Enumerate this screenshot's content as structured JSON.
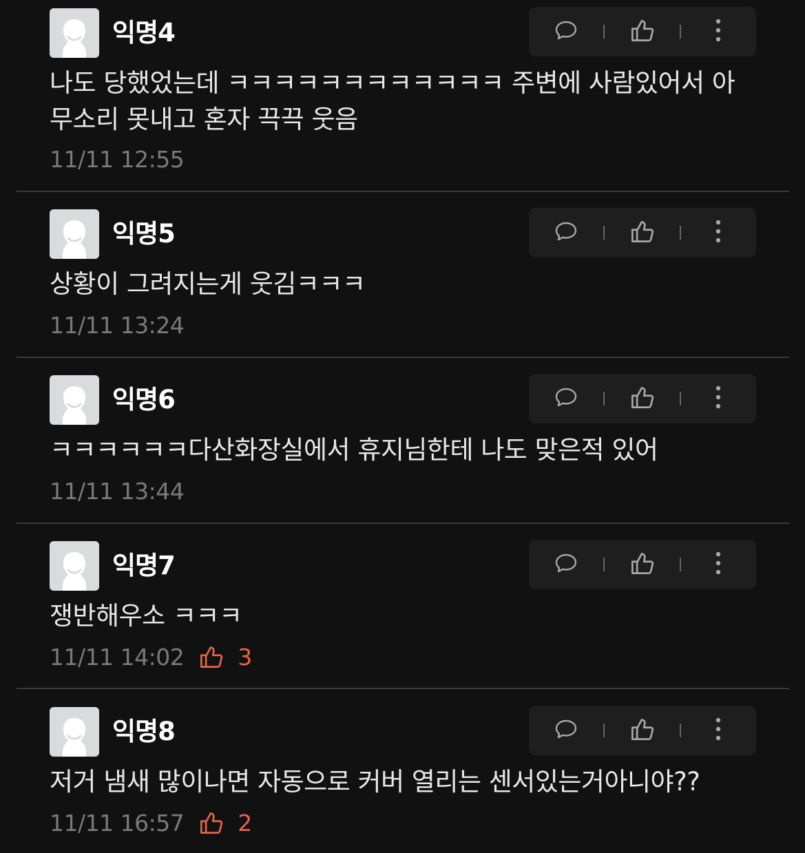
{
  "comments": [
    {
      "author": "익명4",
      "text": "나도 당했었는데 ㅋㅋㅋㅋㅋㅋㅋㅋㅋㅋㅋㅋ 주변에 사람있어서 아무소리 못내고 혼자 끅끅 웃음",
      "time": "11/11 12:55",
      "likes": null
    },
    {
      "author": "익명5",
      "text": "상황이 그려지는게 웃김ㅋㅋㅋ",
      "time": "11/11 13:24",
      "likes": null
    },
    {
      "author": "익명6",
      "text": "ㅋㅋㅋㅋㅋㅋ다산화장실에서 휴지님한테 나도 맞은적 있어",
      "time": "11/11 13:44",
      "likes": null
    },
    {
      "author": "익명7",
      "text": "쟁반해우소 ㅋㅋㅋ",
      "time": "11/11 14:02",
      "likes": "3"
    },
    {
      "author": "익명8",
      "text": "저거 냄새 많이나면 자동으로 커버 열리는 센서있는거아니야??",
      "time": "11/11 16:57",
      "likes": "2"
    }
  ],
  "icons": {
    "avatar": "anonymous-avatar-icon",
    "reply": "speech-bubble-icon",
    "like": "thumbs-up-icon",
    "more": "vertical-ellipsis-icon"
  },
  "colors": {
    "background": "#111111",
    "action_bar": "#1e1e1e",
    "like_count": "#e9634a",
    "meta": "#7a7a7a",
    "divider": "#3a3a3a"
  }
}
